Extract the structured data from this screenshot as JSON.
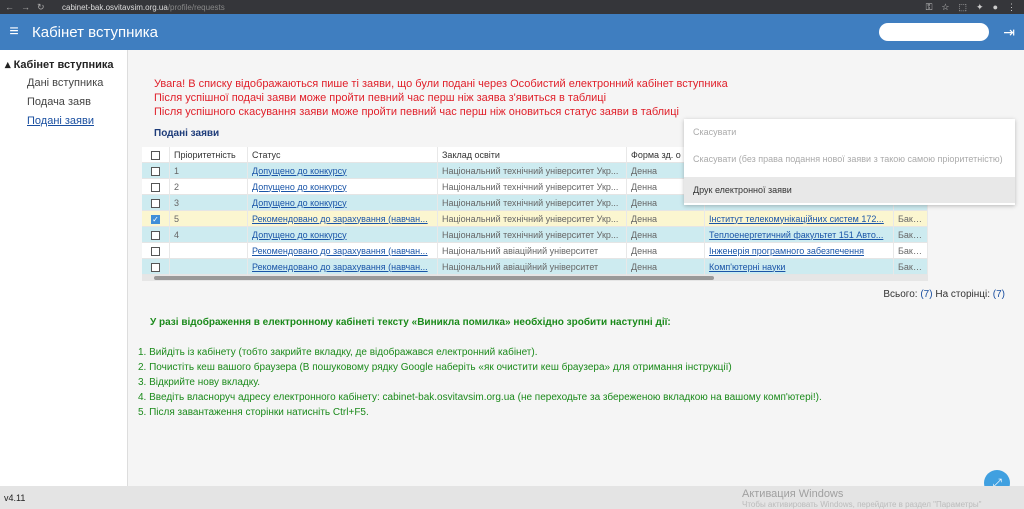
{
  "browser": {
    "url_domain": "cabinet-bak.osvitavsim.org.ua",
    "url_path": "/profile/requests"
  },
  "appbar": {
    "title": "Кабінет вступника"
  },
  "sidebar": {
    "group_label": "Кабінет вступника",
    "items": [
      {
        "label": "Дані вступника"
      },
      {
        "label": "Подача заяв"
      },
      {
        "label": "Подані заяви"
      }
    ]
  },
  "warnings": [
    "Увага! В списку відображаються пише ті заяви, що були подані через Особистий електронний кабінет вступника",
    "Після успішної подачі заяви може пройти певний час перш ніж заява з'явиться в таблиці",
    "Після успішного скасування заяви може пройти певний час перш ніж оновиться статус заяви в таблиці"
  ],
  "section_title": "Подані заяви",
  "table": {
    "headers": [
      "Пріоритетність",
      "Статус",
      "Заклад освіти",
      "Форма зд. о"
    ],
    "rows": [
      {
        "priority": "1",
        "status": "Допущено до конкурсу",
        "institution": "Національний технічний університет Укр...",
        "form": "Денна",
        "faculty": "",
        "level": "",
        "style": "blue",
        "checked": false
      },
      {
        "priority": "2",
        "status": "Допущено до конкурсу",
        "institution": "Національний технічний університет Укр...",
        "form": "Денна",
        "faculty": "",
        "level": "",
        "style": "white",
        "checked": false
      },
      {
        "priority": "3",
        "status": "Допущено до конкурсу",
        "institution": "Національний технічний університет Укр...",
        "form": "Денна",
        "faculty": "",
        "level": "",
        "style": "blue",
        "checked": false
      },
      {
        "priority": "5",
        "status": "Рекомендовано до зарахування (навчан...",
        "institution": "Національний технічний університет Укр...",
        "form": "Денна",
        "faculty": "Інститут телекомунікаційних систем 172...",
        "level": "Бакалавр",
        "style": "yellow",
        "checked": true
      },
      {
        "priority": "4",
        "status": "Допущено до конкурсу",
        "institution": "Національний технічний університет Укр...",
        "form": "Денна",
        "faculty": "Теплоенергетичний факультет 151 Авто...",
        "level": "Бакалавр",
        "style": "blue",
        "checked": false
      },
      {
        "priority": "",
        "status": "Рекомендовано до зарахування (навчан...",
        "institution": "Національний авіаційний університет",
        "form": "Денна",
        "faculty": "Інженерія програмного забезпечення",
        "level": "Бакалавр",
        "style": "white",
        "checked": false
      },
      {
        "priority": "",
        "status": "Рекомендовано до зарахування (навчан...",
        "institution": "Національний авіаційний університет",
        "form": "Денна",
        "faculty": "Комп'ютерні науки",
        "level": "Бакалавр",
        "style": "blue",
        "checked": false
      }
    ]
  },
  "dropdown": {
    "options": [
      "Скасувати",
      "Скасувати (без права подання нової заяви з такою самою пріоритетністю)",
      "Друк електронної заяви"
    ]
  },
  "totals": {
    "total_label": "Всього:",
    "total_value": "(7)",
    "page_label": "На сторінці:",
    "page_value": "(7)"
  },
  "error_help": {
    "title": "У разі відображення в електронному кабінеті тексту «Виникла помилка» необхідно зробити наступні дії:",
    "steps": [
      "1. Вийдіть із кабінету (тобто закрийте вкладку, де відображався електронний кабінет).",
      "2. Почистіть кеш вашого браузера (В пошуковому рядку Google наберіть «як очистити кеш браузера» для отримання інструкції)",
      "3. Відкрийте нову вкладку.",
      "4. Введіть власноруч адресу електронного кабінету: cabinet-bak.osvitavsim.org.ua (не переходьте за збереженою вкладкою на вашому комп'ютері!).",
      "5. Після завантаження сторінки натисніть Ctrl+F5."
    ]
  },
  "footer": {
    "version": "v4.11",
    "watermark_title": "Активация Windows",
    "watermark_sub": "Чтобы активировать Windows, перейдите в раздел \"Параметры\""
  },
  "icons": {
    "menu": "menu-icon",
    "logout": "logout-icon",
    "fab": "fullscreen-icon"
  },
  "colors": {
    "appbar": "#3f7ec0",
    "warning": "#e0202a",
    "help": "#1b8a1b",
    "row_blue": "#cdebf0",
    "row_yellow": "#fbf6d0"
  }
}
